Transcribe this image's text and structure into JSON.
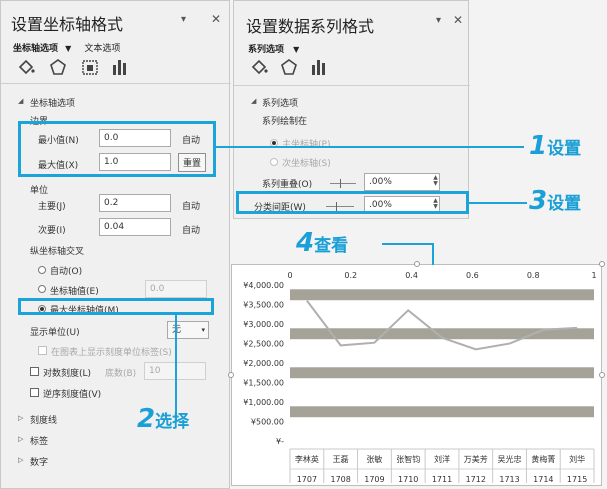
{
  "axis_pane": {
    "title": "设置坐标轴格式",
    "tabs": [
      "坐标轴选项",
      "文本选项"
    ],
    "section": "坐标轴选项",
    "bounds_label": "边界",
    "min_label": "最小值(N)",
    "min_value": "0.0",
    "min_btn": "自动",
    "max_label": "最大值(X)",
    "max_value": "1.0",
    "max_btn": "重置",
    "units_label": "单位",
    "major_label": "主要(J)",
    "major_value": "0.2",
    "major_btn": "自动",
    "minor_label": "次要(I)",
    "minor_value": "0.04",
    "minor_btn": "自动",
    "cross_label": "纵坐标轴交叉",
    "cross_auto": "自动(O)",
    "cross_value_label": "坐标轴值(E)",
    "cross_value": "0.0",
    "cross_max": "最大坐标轴值(M)",
    "display_units_label": "显示单位(U)",
    "display_units_value": "无",
    "show_units_label": "在图表上显示刻度单位标签(S)",
    "log_label": "对数刻度(L)",
    "base_label": "底数(B)",
    "base_value": "10",
    "reverse_label": "逆序刻度值(V)",
    "sections": [
      "刻度线",
      "标签",
      "数字"
    ]
  },
  "series_pane": {
    "title": "设置数据系列格式",
    "tab": "系列选项",
    "section": "系列选项",
    "plot_on": "系列绘制在",
    "primary": "主坐标轴(P)",
    "secondary": "次坐标轴(S)",
    "overlap_label": "系列重叠(O)",
    "overlap_value": ".00%",
    "gap_label": "分类间距(W)",
    "gap_value": ".00%"
  },
  "callouts": [
    {
      "num": "1",
      "text": "设置"
    },
    {
      "num": "2",
      "text": "选择"
    },
    {
      "num": "3",
      "text": "设置"
    },
    {
      "num": "4",
      "text": "查看"
    }
  ],
  "chart_data": {
    "type": "bar",
    "orientation": "horizontal",
    "bar_color": "#a5a297",
    "line_color": "#b0b0b0",
    "top_ticks": [
      "0",
      "0.2",
      "0.4",
      "0.6",
      "0.8",
      "1"
    ],
    "y_ticks": [
      "¥4,000.00",
      "¥3,500.00",
      "¥3,000.00",
      "¥2,500.00",
      "¥2,000.00",
      "¥1,500.00",
      "¥1,000.00",
      "¥500.00",
      "¥-"
    ],
    "ylim": [
      0,
      4000
    ],
    "categories": [
      {
        "name": "李林英",
        "id": "1707"
      },
      {
        "name": "王磊",
        "id": "1708"
      },
      {
        "name": "张敏",
        "id": "1709"
      },
      {
        "name": "张智钧",
        "id": "1710"
      },
      {
        "name": "刘洋",
        "id": "1711"
      },
      {
        "name": "万美芳",
        "id": "1712"
      },
      {
        "name": "吴光忠",
        "id": "1713"
      },
      {
        "name": "黄梅菁",
        "id": "1714"
      },
      {
        "name": "刘华",
        "id": "1715"
      }
    ],
    "line_values": [
      3600,
      2450,
      2520,
      3350,
      2650,
      2350,
      2500,
      2850,
      2900
    ]
  }
}
